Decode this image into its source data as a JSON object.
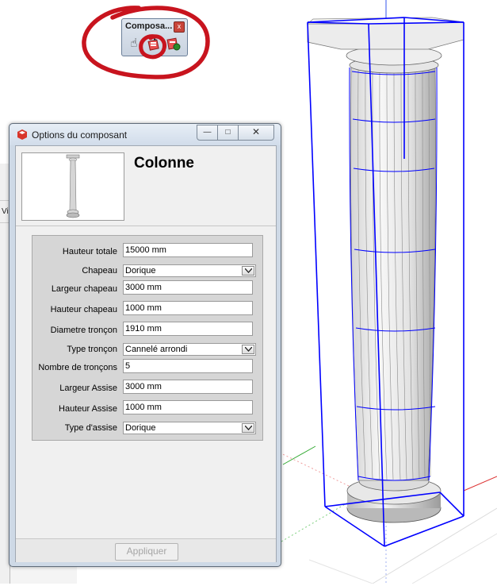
{
  "toolbar": {
    "title": "Composa...",
    "close_glyph": "x",
    "buttons": [
      {
        "icon": "hand-icon",
        "glyph": "☝"
      },
      {
        "icon": "component-options-icon"
      },
      {
        "icon": "component-attributes-icon"
      }
    ],
    "annotation_color": "#c8141e"
  },
  "left_strip": {
    "label": "Vi"
  },
  "dialog": {
    "title": "Options du composant",
    "window_buttons": {
      "minimize": "—",
      "maximize": "□",
      "close": "✕"
    },
    "component_name": "Colonne",
    "fields": [
      {
        "label": "Hauteur totale",
        "type": "text",
        "value": "15000 mm"
      },
      {
        "label": "Chapeau",
        "type": "select",
        "value": "Dorique"
      },
      {
        "label": "Largeur chapeau",
        "type": "text",
        "value": "3000 mm"
      },
      {
        "label": "Hauteur chapeau",
        "type": "text",
        "value": "1000 mm"
      },
      {
        "label": "Diametre tronçon",
        "type": "text",
        "value": "1910 mm"
      },
      {
        "label": "Type tronçon",
        "type": "select",
        "value": "Cannelé arrondi"
      },
      {
        "label": "Nombre de tronçons",
        "type": "text",
        "value": "5"
      },
      {
        "label": "Largeur Assise",
        "type": "text",
        "value": "3000 mm"
      },
      {
        "label": "Hauteur Assise",
        "type": "text",
        "value": "1000 mm"
      },
      {
        "label": "Type d'assise",
        "type": "select",
        "value": "Dorique"
      }
    ],
    "apply_label": "Appliquer",
    "apply_enabled": false
  },
  "colors": {
    "selection_blue": "#0000ff",
    "axis_green": "#22aa22",
    "axis_red": "#dd3333",
    "axis_blue": "#3355ee"
  }
}
